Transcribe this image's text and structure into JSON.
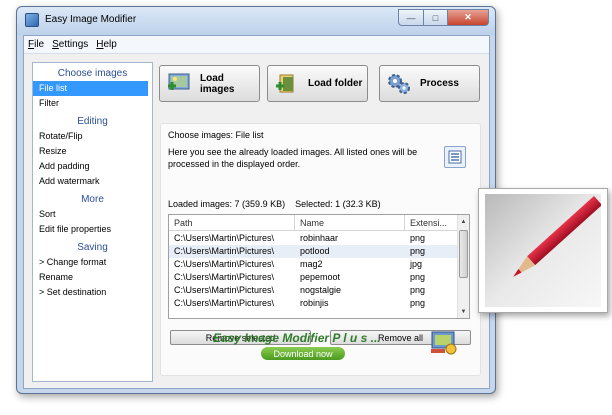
{
  "window": {
    "title": "Easy Image Modifier",
    "min_glyph": "—",
    "max_glyph": "□",
    "close_glyph": "✕"
  },
  "menubar": [
    {
      "u": "F",
      "rest": "ile"
    },
    {
      "u": "S",
      "rest": "ettings"
    },
    {
      "u": "H",
      "rest": "elp"
    }
  ],
  "sidebar": {
    "choose_header": "Choose images",
    "choose_items": [
      "File list",
      "Filter"
    ],
    "editing_header": "Editing",
    "editing_items": [
      "Rotate/Flip",
      "Resize",
      "Add padding",
      "Add watermark"
    ],
    "more_header": "More",
    "more_items": [
      "Sort",
      "Edit file properties"
    ],
    "saving_header": "Saving",
    "saving_items": [
      "> Change format",
      "Rename",
      "> Set destination"
    ]
  },
  "toolbar": {
    "load_images": "Load images",
    "load_folder": "Load folder",
    "process": "Process",
    "load_images_icon": "images-add-icon",
    "load_folder_icon": "folder-add-icon",
    "process_icon": "gears-icon"
  },
  "panel": {
    "title": "Choose images: File list",
    "description": "Here you see the already loaded images. All listed ones will be processed in the displayed order.",
    "list_icon": "list-icon"
  },
  "info": {
    "loaded": "Loaded images: 7 (359.9 KB)",
    "selected": "Selected: 1 (32.3 KB)"
  },
  "table": {
    "columns": [
      "Path",
      "Name",
      "Extensi..."
    ],
    "rows": [
      {
        "path": "C:\\Users\\Martin\\Pictures\\",
        "name": "robinhaar",
        "ext": "png"
      },
      {
        "path": "C:\\Users\\Martin\\Pictures\\",
        "name": "potlood",
        "ext": "png"
      },
      {
        "path": "C:\\Users\\Martin\\Pictures\\",
        "name": "mag2",
        "ext": "jpg"
      },
      {
        "path": "C:\\Users\\Martin\\Pictures\\",
        "name": "pepemoot",
        "ext": "png"
      },
      {
        "path": "C:\\Users\\Martin\\Pictures\\",
        "name": "nogstalgie",
        "ext": "png"
      },
      {
        "path": "C:\\Users\\Martin\\Pictures\\",
        "name": "robinjis",
        "ext": "png"
      }
    ],
    "selected_row": 1,
    "scroll_up": "▲",
    "scroll_down": "▼"
  },
  "buttons": {
    "remove_selected": "Remove selected",
    "remove_all": "Remove all"
  },
  "promo": {
    "text": "Easy Image Modifier P l u s ...",
    "download": "Download now"
  },
  "colors": {
    "selection": "#3399ff",
    "accent": "#2f7d2a",
    "section_header": "#2a4f96"
  }
}
